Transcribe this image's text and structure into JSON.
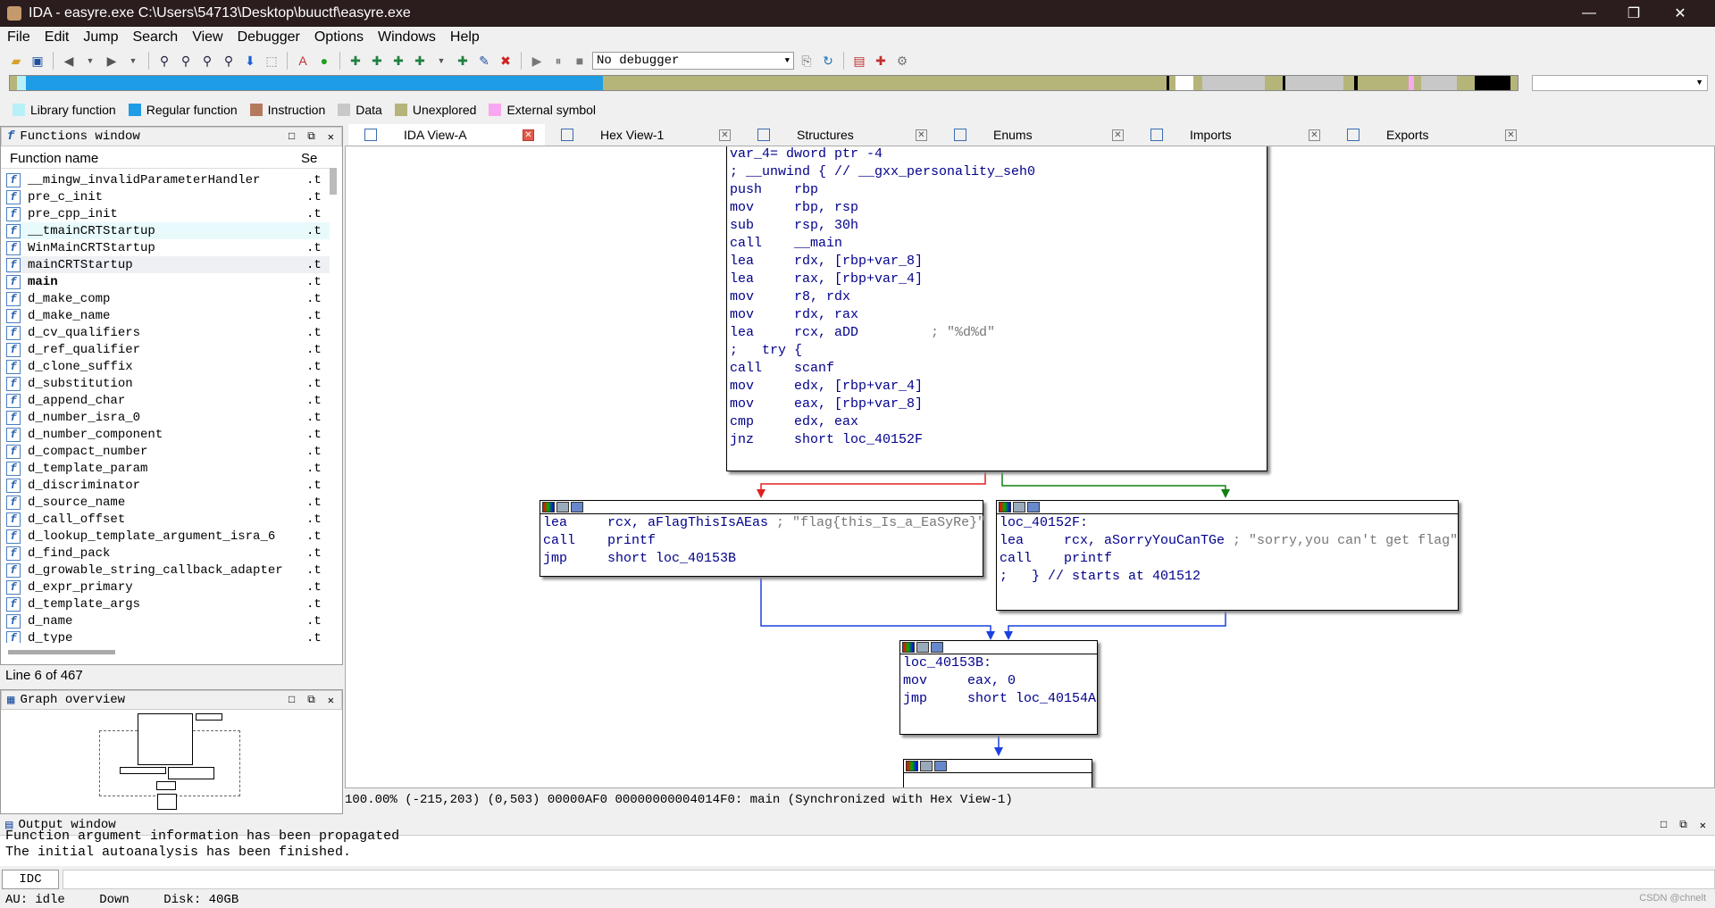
{
  "window": {
    "title": "IDA - easyre.exe C:\\Users\\54713\\Desktop\\buuctf\\easyre.exe",
    "min": "—",
    "max": "❐",
    "close": "✕"
  },
  "menu": [
    "File",
    "Edit",
    "Jump",
    "Search",
    "View",
    "Debugger",
    "Options",
    "Windows",
    "Help"
  ],
  "toolbar": {
    "debugger_select": "No debugger"
  },
  "legend": [
    {
      "label": "Library function",
      "color": "#b8f0f8"
    },
    {
      "label": "Regular function",
      "color": "#1e9ce6"
    },
    {
      "label": "Instruction",
      "color": "#b47a5e"
    },
    {
      "label": "Data",
      "color": "#c8c8c8"
    },
    {
      "label": "Unexplored",
      "color": "#b5b57a"
    },
    {
      "label": "External symbol",
      "color": "#f8a8f0"
    }
  ],
  "functions_window": {
    "title": "Functions window",
    "col_name": "Function name",
    "col_seg": "Se",
    "items": [
      {
        "name": "__mingw_invalidParameterHandler",
        "seg": ".t"
      },
      {
        "name": "pre_c_init",
        "seg": ".t"
      },
      {
        "name": "pre_cpp_init",
        "seg": ".t"
      },
      {
        "name": "__tmainCRTStartup",
        "seg": ".t"
      },
      {
        "name": "WinMainCRTStartup",
        "seg": ".t"
      },
      {
        "name": "mainCRTStartup",
        "seg": ".t"
      },
      {
        "name": "main",
        "seg": ".t"
      },
      {
        "name": "d_make_comp",
        "seg": ".t"
      },
      {
        "name": "d_make_name",
        "seg": ".t"
      },
      {
        "name": "d_cv_qualifiers",
        "seg": ".t"
      },
      {
        "name": "d_ref_qualifier",
        "seg": ".t"
      },
      {
        "name": "d_clone_suffix",
        "seg": ".t"
      },
      {
        "name": "d_substitution",
        "seg": ".t"
      },
      {
        "name": "d_append_char",
        "seg": ".t"
      },
      {
        "name": "d_number_isra_0",
        "seg": ".t"
      },
      {
        "name": "d_number_component",
        "seg": ".t"
      },
      {
        "name": "d_compact_number",
        "seg": ".t"
      },
      {
        "name": "d_template_param",
        "seg": ".t"
      },
      {
        "name": "d_discriminator",
        "seg": ".t"
      },
      {
        "name": "d_source_name",
        "seg": ".t"
      },
      {
        "name": "d_call_offset",
        "seg": ".t"
      },
      {
        "name": "d_lookup_template_argument_isra_6",
        "seg": ".t"
      },
      {
        "name": "d_find_pack",
        "seg": ".t"
      },
      {
        "name": "d_growable_string_callback_adapter",
        "seg": ".t"
      },
      {
        "name": "d_expr_primary",
        "seg": ".t"
      },
      {
        "name": "d_template_args",
        "seg": ".t"
      },
      {
        "name": "d_name",
        "seg": ".t"
      },
      {
        "name": "d_type",
        "seg": ".t"
      }
    ],
    "line_info": "Line 6 of 467"
  },
  "graph_overview": {
    "title": "Graph overview"
  },
  "tabs": [
    {
      "label": "IDA View-A"
    },
    {
      "label": "Hex View-1"
    },
    {
      "label": "Structures"
    },
    {
      "label": "Enums"
    },
    {
      "label": "Imports"
    },
    {
      "label": "Exports"
    }
  ],
  "node_main": [
    {
      "t": "var_4= dword ptr -4"
    },
    {
      "t": ""
    },
    {
      "t": "; __unwind { // __gxx_personality_seh0"
    },
    {
      "t": "push    rbp"
    },
    {
      "t": "mov     rbp, rsp"
    },
    {
      "t": "sub     rsp, 30h"
    },
    {
      "t": "call    __main"
    },
    {
      "t": "lea     rdx, [rbp+var_8]"
    },
    {
      "t": "lea     rax, [rbp+var_4]"
    },
    {
      "t": "mov     r8, rdx"
    },
    {
      "t": "mov     rdx, rax"
    },
    {
      "t": "lea     rcx, aDD         ; \"%d%d\""
    },
    {
      "t": ";   try {"
    },
    {
      "t": "call    scanf"
    },
    {
      "t": "mov     edx, [rbp+var_4]"
    },
    {
      "t": "mov     eax, [rbp+var_8]"
    },
    {
      "t": "cmp     edx, eax"
    },
    {
      "t": "jnz     short loc_40152F"
    }
  ],
  "node_flag": [
    {
      "t": "lea     rcx, aFlagThisIsAEas ; \"flag{this_Is_a_EaSyRe}\""
    },
    {
      "t": "call    printf"
    },
    {
      "t": "jmp     short loc_40153B"
    }
  ],
  "node_sorry": [
    {
      "t": ""
    },
    {
      "t": "loc_40152F:"
    },
    {
      "t": "lea     rcx, aSorryYouCanTGe ; \"sorry,you can't get flag\""
    },
    {
      "t": "call    printf"
    },
    {
      "t": ";   } // starts at 401512"
    }
  ],
  "node_end": [
    {
      "t": ""
    },
    {
      "t": "loc_40153B:"
    },
    {
      "t": "mov     eax, 0"
    },
    {
      "t": "jmp     short loc_40154A"
    }
  ],
  "graph_status": "100.00% (-215,203) (0,503) 00000AF0 00000000004014F0: main (Synchronized with Hex View-1)",
  "output": {
    "title": "Output window",
    "lines": [
      "Function argument information has been propagated",
      "The initial autoanalysis has been finished."
    ],
    "idc_button": "IDC"
  },
  "statusbar": {
    "au_label": "AU:",
    "au": "idle",
    "dir": "Down",
    "disk": "Disk: 40GB"
  },
  "watermark": "CSDN @chnelt"
}
